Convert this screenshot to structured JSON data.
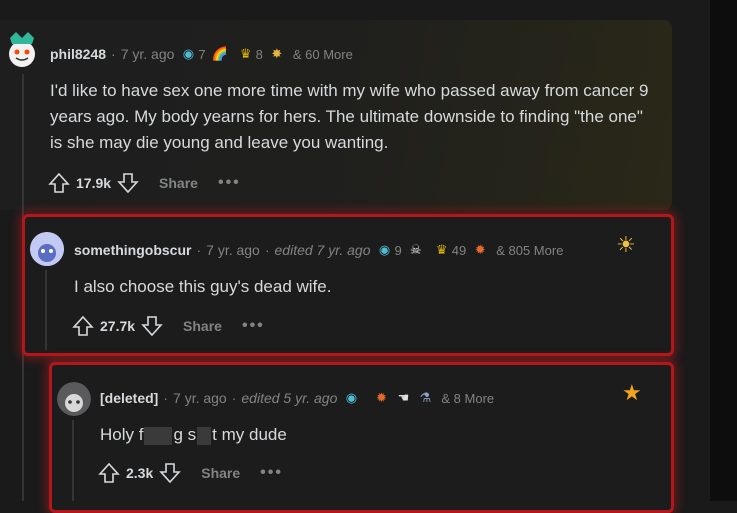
{
  "comments": [
    {
      "username": "phil8248",
      "age": "7 yr. ago",
      "awards": [
        {
          "icon": "wholesome-icon",
          "glyph": "◉",
          "color": "#4fbcd4",
          "count": "7"
        },
        {
          "icon": "rainbow-icon",
          "glyph": "🌈",
          "color": "#e8a33a",
          "count": ""
        },
        {
          "icon": "gold-award-icon",
          "glyph": "♛",
          "color": "#e6b800",
          "count": "8"
        },
        {
          "icon": "explosion-award-icon",
          "glyph": "✸",
          "color": "#e2b53e",
          "count": ""
        }
      ],
      "more": "& 60 More",
      "body": "I'd like to have sex one more time with my wife who passed away from cancer 9 years ago. My body yearns for hers. The ultimate downside to finding \"the one\" is she may die young and leave you wanting.",
      "score": "17.9k",
      "share": "Share",
      "dots": "•••"
    },
    {
      "username": "somethingobscur",
      "age": "7 yr. ago",
      "edited": "edited 7 yr. ago",
      "awards": [
        {
          "icon": "wholesome-icon",
          "glyph": "◉",
          "color": "#4fbcd4",
          "count": "9"
        },
        {
          "icon": "skull-award-icon",
          "glyph": "☠",
          "color": "#e0e0e0",
          "count": ""
        },
        {
          "icon": "gold-award-icon",
          "glyph": "♛",
          "color": "#e6b800",
          "count": "49"
        },
        {
          "icon": "burst-award-icon",
          "glyph": "✹",
          "color": "#e66b2a",
          "count": ""
        }
      ],
      "more": "& 805 More",
      "body": "I also choose this guy's dead wife.",
      "score": "27.7k",
      "share": "Share",
      "dots": "•••"
    },
    {
      "username": "[deleted]",
      "age": "7 yr. ago",
      "edited": "edited 5 yr. ago",
      "awards": [
        {
          "icon": "wholesome-icon",
          "glyph": "◉",
          "color": "#4fbcd4",
          "count": ""
        },
        {
          "icon": "burst-award-icon",
          "glyph": "✹",
          "color": "#e66b2a",
          "count": ""
        },
        {
          "icon": "hands-award-icon",
          "glyph": "☚",
          "color": "#e0e0e0",
          "count": ""
        },
        {
          "icon": "bottle-award-icon",
          "glyph": "⚗",
          "color": "#8aa0c8",
          "count": ""
        }
      ],
      "more": "& 8 More",
      "body_parts": [
        "Holy f",
        "g s",
        "t my dude"
      ],
      "score": "2.3k",
      "share": "Share",
      "dots": "•••"
    }
  ]
}
